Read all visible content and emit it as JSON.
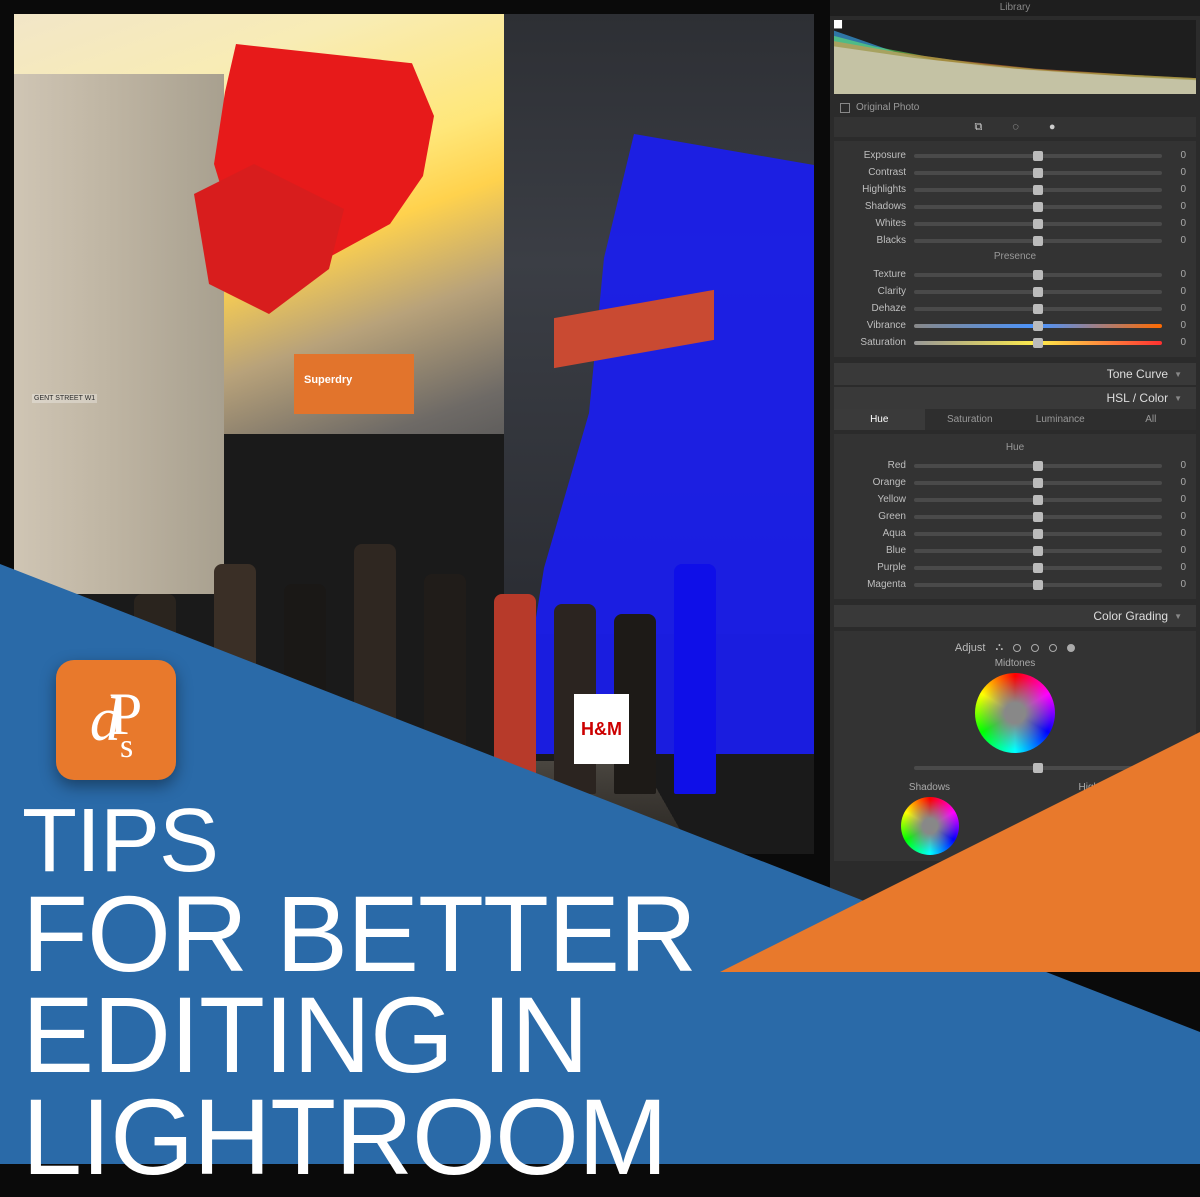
{
  "app": {
    "module": "Library"
  },
  "photo": {
    "awning_label": "Superdry",
    "street_sign": "GENT STREET W1",
    "bag_logo": "H&M"
  },
  "panel": {
    "original_label": "Original Photo",
    "basic": {
      "sliders": [
        {
          "label": "Exposure",
          "value": "0"
        },
        {
          "label": "Contrast",
          "value": "0"
        },
        {
          "label": "Highlights",
          "value": "0"
        },
        {
          "label": "Shadows",
          "value": "0"
        },
        {
          "label": "Whites",
          "value": "0"
        },
        {
          "label": "Blacks",
          "value": "0"
        }
      ],
      "presence_label": "Presence",
      "presence": [
        {
          "label": "Texture",
          "value": "0"
        },
        {
          "label": "Clarity",
          "value": "0"
        },
        {
          "label": "Dehaze",
          "value": "0"
        },
        {
          "label": "Vibrance",
          "value": "0"
        },
        {
          "label": "Saturation",
          "value": "0"
        }
      ]
    },
    "tone_curve_label": "Tone Curve",
    "hsl_label": "HSL / Color",
    "hsl_tabs": [
      "Hue",
      "Saturation",
      "Luminance",
      "All"
    ],
    "hsl_active": "Hue",
    "hue_header": "Hue",
    "hue": [
      {
        "label": "Red",
        "c1": "#d94fd9",
        "c2": "#ff8a00",
        "value": "0"
      },
      {
        "label": "Orange",
        "c1": "#ff3a00",
        "c2": "#ffe000",
        "value": "0"
      },
      {
        "label": "Yellow",
        "c1": "#ffb000",
        "c2": "#a8ff00",
        "value": "0"
      },
      {
        "label": "Green",
        "c1": "#d6ff00",
        "c2": "#00ff9a",
        "value": "0"
      },
      {
        "label": "Aqua",
        "c1": "#00ff6a",
        "c2": "#00a8ff",
        "value": "0"
      },
      {
        "label": "Blue",
        "c1": "#00d6ff",
        "c2": "#4a4aff",
        "value": "0"
      },
      {
        "label": "Purple",
        "c1": "#5a5aff",
        "c2": "#d64aff",
        "value": "0"
      },
      {
        "label": "Magenta",
        "c1": "#a84aff",
        "c2": "#ff4a8a",
        "value": "0"
      }
    ],
    "color_grading": {
      "label": "Color Grading",
      "adjust_label": "Adjust",
      "midtones": "Midtones",
      "shadows": "Shadows",
      "highlights": "Highlights"
    }
  },
  "overlay": {
    "logo": "dPs",
    "headline_l1": "TIPS",
    "headline_l2": "FOR BETTER",
    "headline_l3": "EDITING IN LIGHTROOM"
  }
}
